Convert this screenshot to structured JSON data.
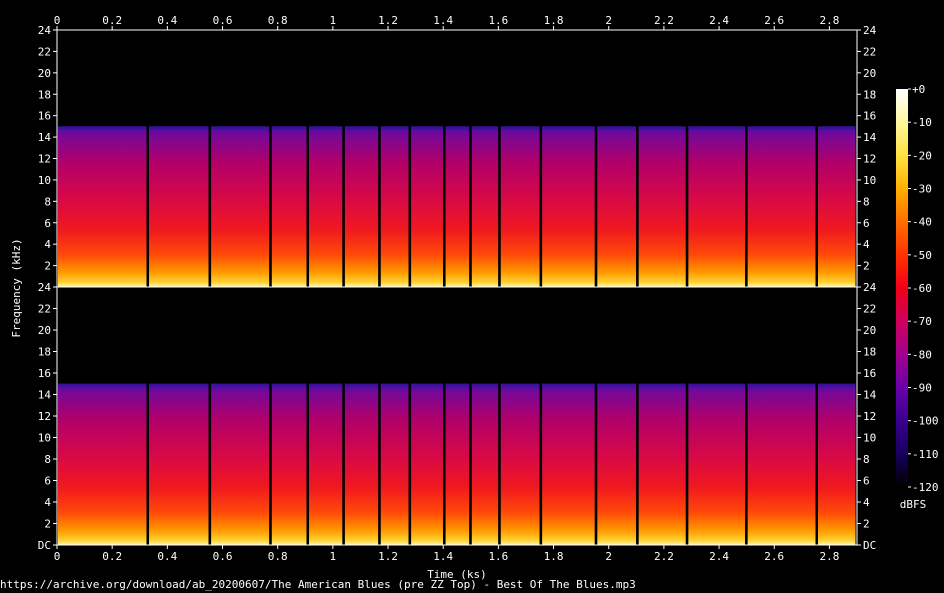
{
  "source_caption": "https://archive.org/download/ab_20200607/The American Blues (pre ZZ Top) - Best Of The Blues.mp3",
  "chart_data": {
    "type": "heatmap",
    "subtype": "spectrogram",
    "xlabel": "Time (ks)",
    "ylabel": "Frequency (kHz)",
    "xlim": [
      0,
      2.9
    ],
    "x_ticks": [
      "0",
      "0.2",
      "0.4",
      "0.6",
      "0.8",
      "1",
      "1.2",
      "1.4",
      "1.6",
      "1.8",
      "2",
      "2.2",
      "2.4",
      "2.6",
      "2.8"
    ],
    "x_tick_values": [
      0,
      0.2,
      0.4,
      0.6,
      0.8,
      1.0,
      1.2,
      1.4,
      1.6,
      1.8,
      2.0,
      2.2,
      2.4,
      2.6,
      2.8
    ],
    "ylim": [
      0,
      24
    ],
    "y_ticks": [
      "DC",
      "2",
      "4",
      "6",
      "8",
      "10",
      "12",
      "14",
      "16",
      "18",
      "20",
      "22",
      "24"
    ],
    "y_tick_values": [
      0,
      2,
      4,
      6,
      8,
      10,
      12,
      14,
      16,
      18,
      20,
      22,
      24
    ],
    "channels": 2,
    "grid": false,
    "frequency_cutoff_khz": 15,
    "track_boundaries_ks": [
      0.33,
      0.555,
      0.775,
      0.91,
      1.04,
      1.17,
      1.28,
      1.405,
      1.5,
      1.605,
      1.755,
      1.955,
      2.105,
      2.285,
      2.5,
      2.755,
      2.9
    ],
    "colorbar": {
      "label": "dBFS",
      "range": [
        -120,
        0
      ],
      "ticks": [
        "+0",
        "-10",
        "-20",
        "-30",
        "-40",
        "-50",
        "-60",
        "-70",
        "-80",
        "-90",
        "-100",
        "-110",
        "-120"
      ],
      "tick_values": [
        0,
        -10,
        -20,
        -30,
        -40,
        -50,
        -60,
        -70,
        -80,
        -90,
        -100,
        -110,
        -120
      ],
      "colors": [
        "#ffffff",
        "#fff8a0",
        "#ffe040",
        "#ffb000",
        "#ff7000",
        "#ff3000",
        "#f00018",
        "#d0005a",
        "#a00090",
        "#6a00a8",
        "#3a0090",
        "#14005c",
        "#000000"
      ]
    },
    "palette": {
      "hot": "#ffe060",
      "mid": "#ff2a20",
      "cool": "#c8005a",
      "cold": "#5a10a0",
      "void": "#000000",
      "text": "#ffffff"
    }
  }
}
